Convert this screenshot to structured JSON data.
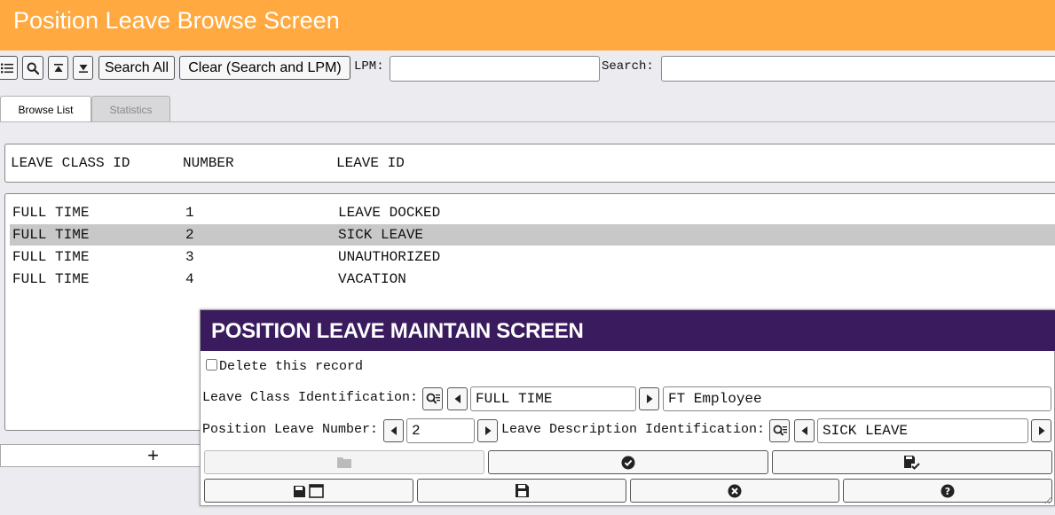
{
  "app": {
    "title": "Position Leave Browse Screen"
  },
  "toolbar": {
    "list_icon": "list-icon",
    "search_icon": "magnifier-icon",
    "prev_icon": "arrow-up-icon",
    "next_icon": "arrow-down-icon",
    "search_all_label": "Search All",
    "clear_label": "Clear (Search and LPM)",
    "lpm_label": "LPM:",
    "lpm_value": "",
    "search_label": "Search:",
    "search_value": ""
  },
  "tabs": [
    {
      "label": "Browse List",
      "active": true
    },
    {
      "label": "Statistics",
      "active": false
    }
  ],
  "browse": {
    "columns": [
      "LEAVE CLASS ID",
      "NUMBER",
      "LEAVE ID"
    ],
    "rows": [
      {
        "leave_class_id": "FULL TIME",
        "number": "1",
        "leave_id": "LEAVE DOCKED"
      },
      {
        "leave_class_id": "FULL TIME",
        "number": "2",
        "leave_id": "SICK LEAVE"
      },
      {
        "leave_class_id": "FULL TIME",
        "number": "3",
        "leave_id": "UNAUTHORIZED"
      },
      {
        "leave_class_id": "FULL TIME",
        "number": "4",
        "leave_id": "VACATION"
      }
    ],
    "selected_row": 2,
    "add_label": "+"
  },
  "maintain": {
    "title": "POSITION LEAVE MAINTAIN SCREEN",
    "delete_label": "Delete this record",
    "delete_checked": false,
    "leave_class_label": "Leave Class Identification:",
    "leave_class_value": "FULL TIME",
    "leave_class_desc": "FT Employee",
    "position_leave_number_label": "Position Leave Number:",
    "position_leave_number_value": "2",
    "leave_desc_label": "Leave Description Identification:",
    "leave_desc_value": "SICK LEAVE",
    "action_icons_row1": [
      "folder-icon",
      "check-circle-icon",
      "save-check-icon"
    ],
    "action_icons_row2": [
      "save-new-window-icon",
      "save-icon",
      "close-circle-icon",
      "help-circle-icon"
    ]
  },
  "colors": {
    "title_bar": "#ffa940",
    "dialog_title": "#3a1b5e",
    "selected_row": "#c8c8c8"
  }
}
